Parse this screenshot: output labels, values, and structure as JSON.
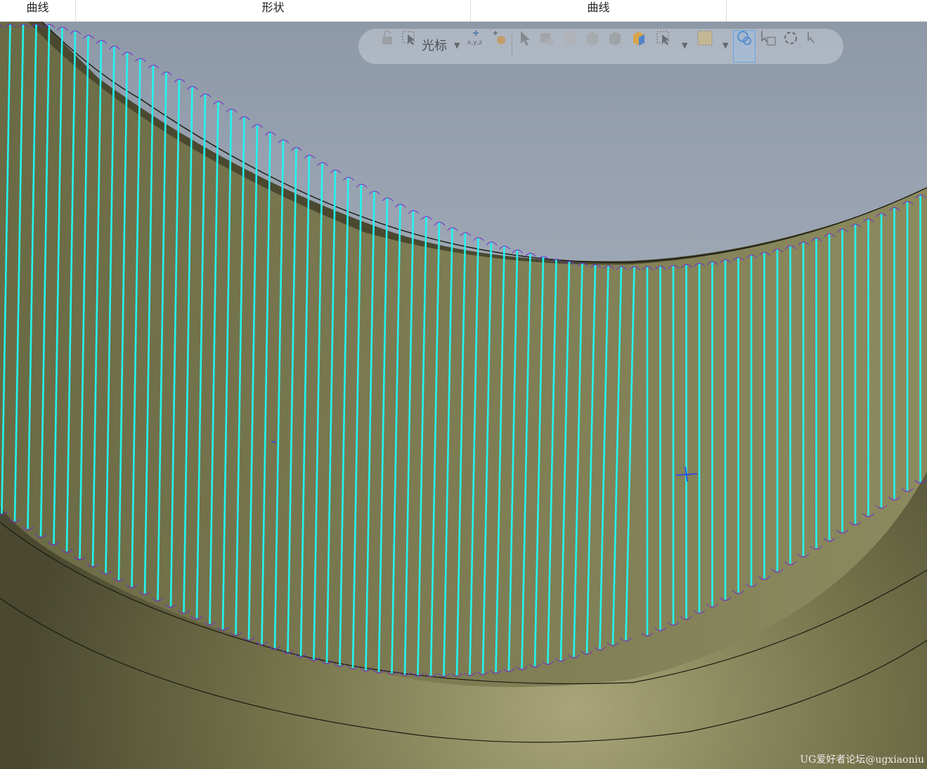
{
  "ribbon": {
    "groups": [
      {
        "label": "曲线"
      },
      {
        "label": "形状"
      },
      {
        "label": "曲线"
      },
      {
        "label": ""
      }
    ]
  },
  "selection_toolbar": {
    "filter_label": "光标",
    "coord_label": "x,y,z",
    "icons": [
      "lock-icon",
      "select-cursor-icon",
      "coordinate-icon",
      "snap-settings-icon",
      "arrow-cursor-icon",
      "shade-icon",
      "face-icon",
      "solid-icon",
      "body-icon",
      "view-cube-icon",
      "select-box-icon",
      "select-region-icon",
      "select-intent-icon",
      "deselect-icon",
      "rotate-icon",
      "undo-icon"
    ]
  },
  "colors": {
    "viewport_background": "#a6b0be",
    "surface": "#7e7d52",
    "surface_dark": "#4e4d30",
    "curve_lines": "#22f5f0",
    "curve_ends": "#7030d0"
  },
  "watermark": "UG爱好者论坛@ugxiaoniu"
}
